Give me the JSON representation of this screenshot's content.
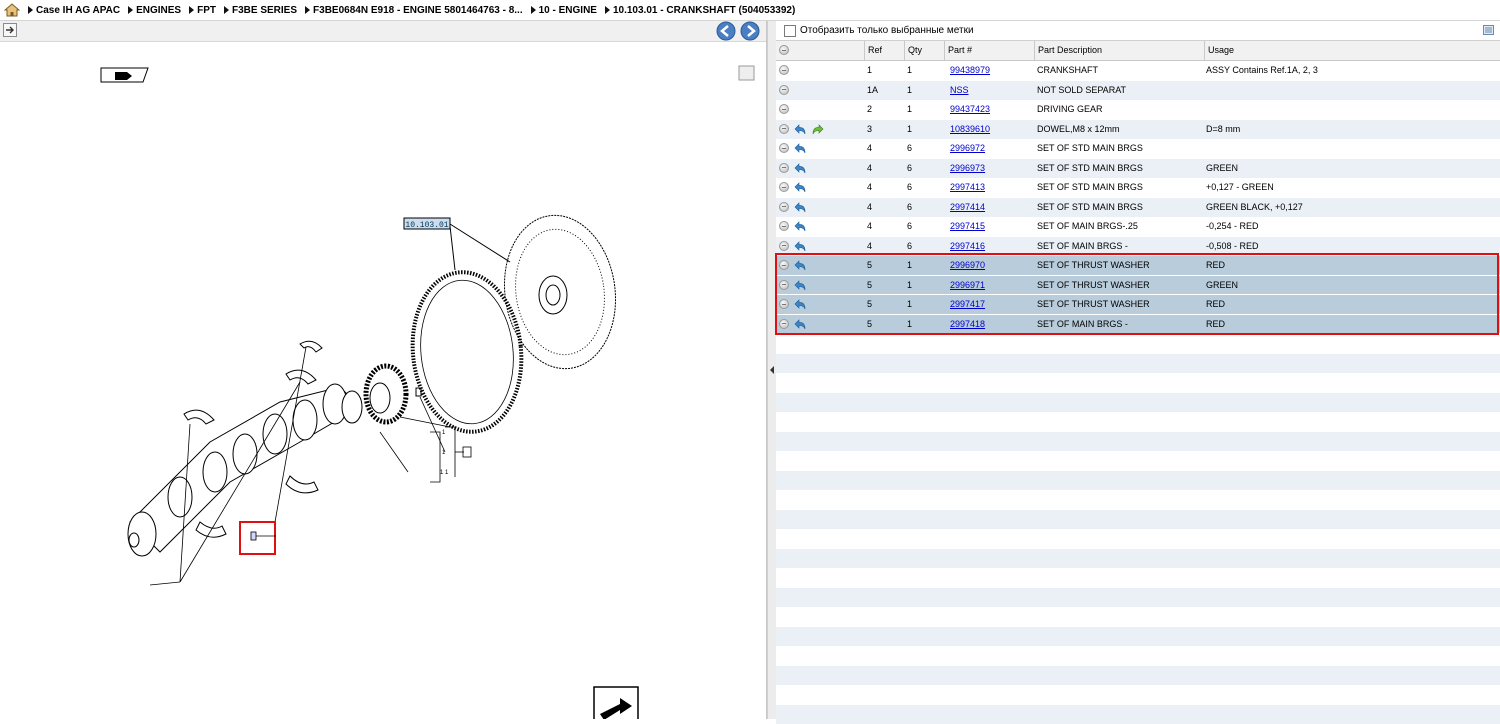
{
  "breadcrumb": [
    "Case IH AG APAC",
    "ENGINES",
    "FPT",
    "F3BE SERIES",
    "F3BE0684N E918 - ENGINE 5801464763 - 8...",
    "10 - ENGINE",
    "10.103.01 - CRANKSHAFT  (504053392)"
  ],
  "diagram": {
    "callout_label": "10.103.01"
  },
  "filter": {
    "label": "Отобразить только выбранные метки"
  },
  "grid": {
    "headers": {
      "ref": "Ref",
      "qty": "Qty",
      "part": "Part #",
      "desc": "Part Description",
      "usage": "Usage"
    },
    "rows": [
      {
        "ref": "1",
        "qty": "1",
        "part": "99438979",
        "desc": "CRANKSHAFT",
        "usage": "ASSY Contains Ref.1A, 2, 3",
        "back": false,
        "fwd": false,
        "selected": false
      },
      {
        "ref": "1A",
        "qty": "1",
        "part": "NSS",
        "desc": "NOT SOLD SEPARAT",
        "usage": "",
        "back": false,
        "fwd": false,
        "selected": false
      },
      {
        "ref": "2",
        "qty": "1",
        "part": "99437423",
        "desc": "DRIVING GEAR",
        "usage": "",
        "back": false,
        "fwd": false,
        "selected": false
      },
      {
        "ref": "3",
        "qty": "1",
        "part": "10839610",
        "desc": "DOWEL,M8 x 12mm",
        "usage": "D=8 mm",
        "back": true,
        "fwd": true,
        "selected": false
      },
      {
        "ref": "4",
        "qty": "6",
        "part": "2996972",
        "desc": "SET OF STD MAIN BRGS",
        "usage": "",
        "back": true,
        "fwd": false,
        "selected": false
      },
      {
        "ref": "4",
        "qty": "6",
        "part": "2996973",
        "desc": "SET OF STD MAIN BRGS",
        "usage": "GREEN",
        "back": true,
        "fwd": false,
        "selected": false
      },
      {
        "ref": "4",
        "qty": "6",
        "part": "2997413",
        "desc": "SET OF STD MAIN BRGS",
        "usage": "+0,127 - GREEN",
        "back": true,
        "fwd": false,
        "selected": false
      },
      {
        "ref": "4",
        "qty": "6",
        "part": "2997414",
        "desc": "SET OF STD MAIN BRGS",
        "usage": "GREEN BLACK, +0,127",
        "back": true,
        "fwd": false,
        "selected": false
      },
      {
        "ref": "4",
        "qty": "6",
        "part": "2997415",
        "desc": "SET OF MAIN BRGS-.25",
        "usage": "-0,254 - RED",
        "back": true,
        "fwd": false,
        "selected": false
      },
      {
        "ref": "4",
        "qty": "6",
        "part": "2997416",
        "desc": "SET OF MAIN BRGS   -",
        "usage": "-0,508 - RED",
        "back": true,
        "fwd": false,
        "selected": false
      },
      {
        "ref": "5",
        "qty": "1",
        "part": "2996970",
        "desc": "SET OF THRUST WASHER",
        "usage": "RED",
        "back": true,
        "fwd": false,
        "selected": true
      },
      {
        "ref": "5",
        "qty": "1",
        "part": "2996971",
        "desc": "SET OF THRUST WASHER",
        "usage": "GREEN",
        "back": true,
        "fwd": false,
        "selected": true
      },
      {
        "ref": "5",
        "qty": "1",
        "part": "2997417",
        "desc": "SET OF THRUST WASHER",
        "usage": "RED",
        "back": true,
        "fwd": false,
        "selected": true
      },
      {
        "ref": "5",
        "qty": "1",
        "part": "2997418",
        "desc": "SET OF MAIN BRGS   -",
        "usage": "RED",
        "back": true,
        "fwd": false,
        "selected": true
      }
    ]
  },
  "icons": {
    "home": "home-icon",
    "back": "back-arrow-icon",
    "forward": "forward-arrow-icon",
    "nav_prev": "nav-prev-icon",
    "nav_next": "nav-next-icon",
    "list_view": "list-view-icon"
  },
  "colors": {
    "selected_row": "#b8ccdb",
    "highlight_border": "#e01010",
    "link": "#0000cc"
  }
}
